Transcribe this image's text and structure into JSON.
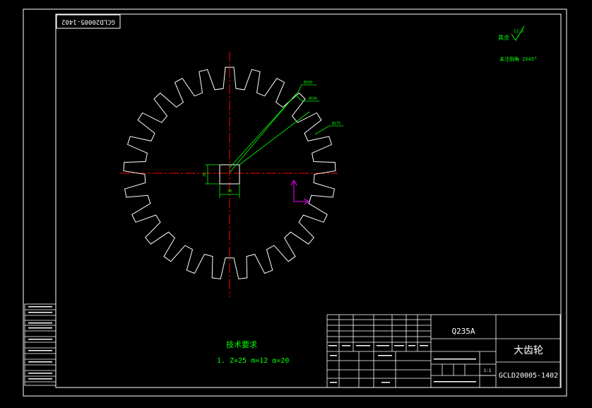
{
  "drawing_number_rotated": "GCLD20005-1402",
  "roughness": {
    "prefix": "其余",
    "value": "12.5"
  },
  "chamfer_note": "未注倒角 2X45°",
  "dim_labels": {
    "d1": "Ø160",
    "d2": "Ø145",
    "d3": "Ø175",
    "bore_h": "30",
    "bore_w": "30"
  },
  "tech_req": {
    "title": "技术要求",
    "line1": "1. Z=25 m=12 α=20"
  },
  "title_block": {
    "material": "Q235A",
    "part_name": "大齿轮",
    "drawing_number": "GCLD20005-1402",
    "scale": "1:1"
  },
  "colors": {
    "outline": "#ffffff",
    "centerline": "#ff0000",
    "dimension": "#00ff00",
    "ucs": "#ff00ff"
  }
}
